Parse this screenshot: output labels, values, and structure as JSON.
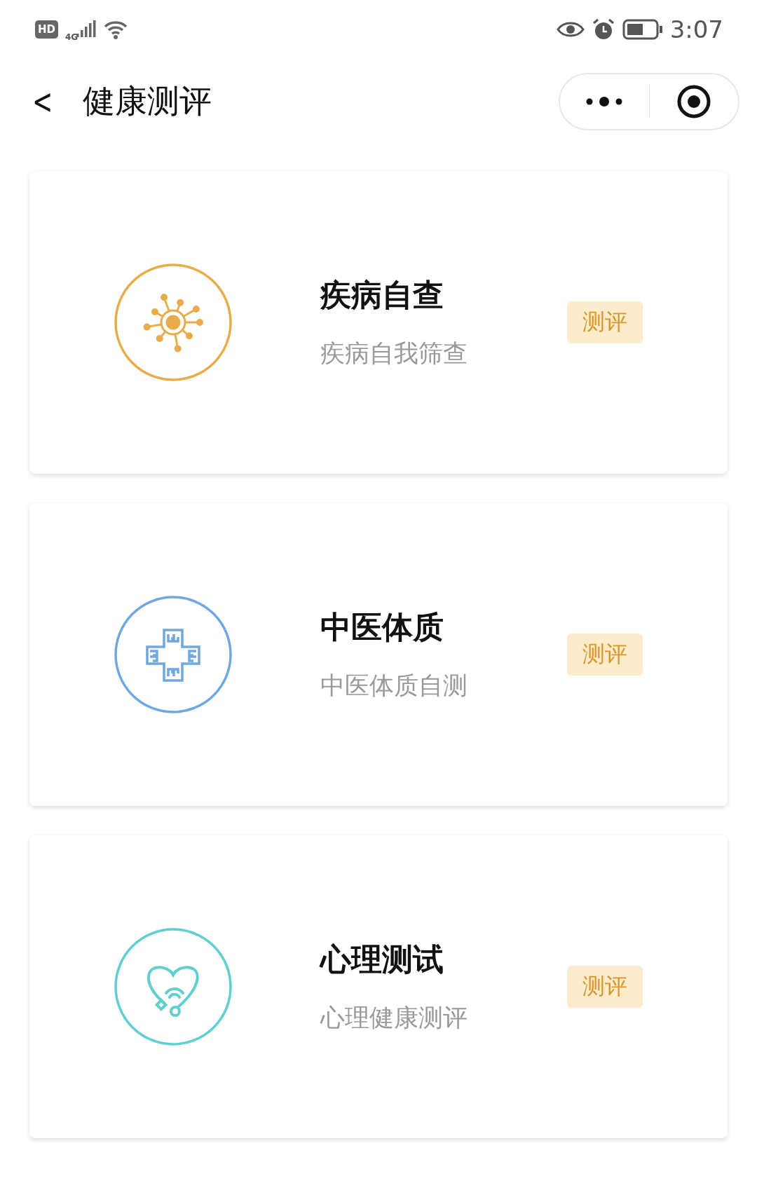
{
  "status_bar": {
    "hd": "HD",
    "network": "4G",
    "time": "3:07"
  },
  "header": {
    "back": "<",
    "title": "健康测评"
  },
  "cards": [
    {
      "kind": "virus",
      "color": "#e8ad4a",
      "title": "疾病自查",
      "subtitle": "疾病自我筛查",
      "badge": "测评"
    },
    {
      "kind": "cross",
      "color": "#6fa8e0",
      "title": "中医体质",
      "subtitle": "中医体质自测",
      "badge": "测评"
    },
    {
      "kind": "heart",
      "color": "#5fcfcf",
      "title": "心理测试",
      "subtitle": "心理健康测评",
      "badge": "测评"
    }
  ]
}
